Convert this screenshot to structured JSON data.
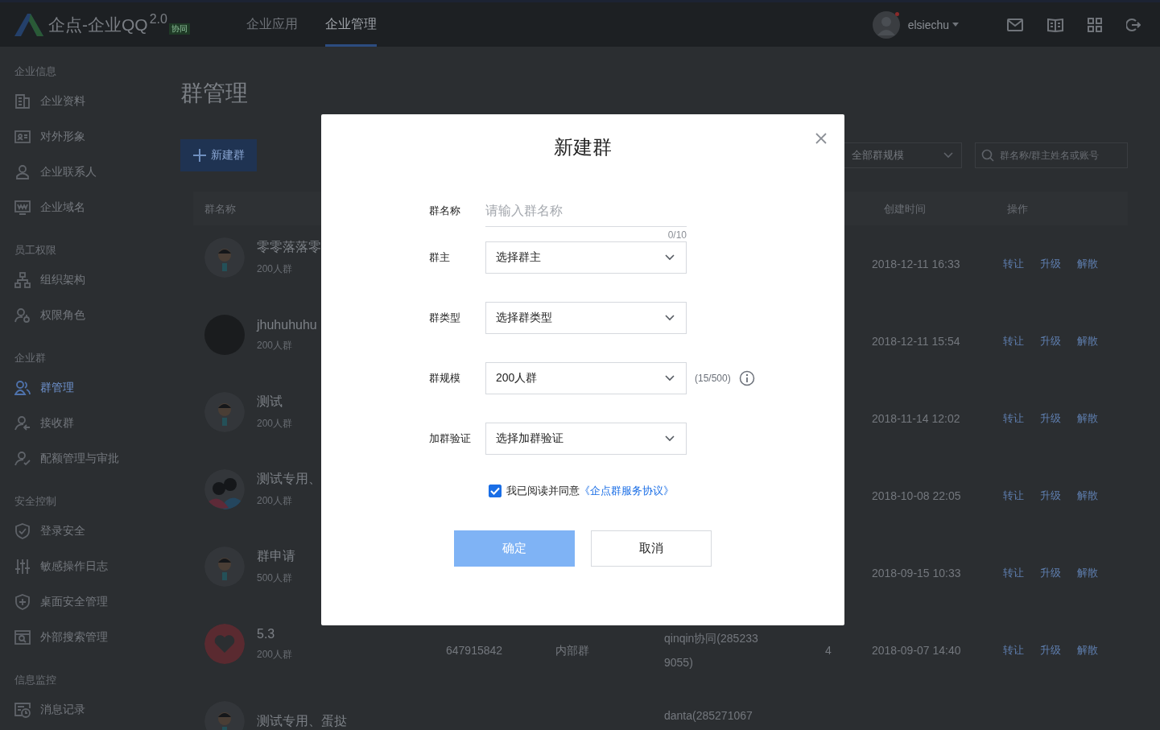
{
  "topbar": {
    "brand": "企点-企业QQ",
    "version": "2.0",
    "badge": "协同",
    "nav": [
      {
        "label": "企业应用",
        "selected": false
      },
      {
        "label": "企业管理",
        "selected": true
      }
    ],
    "user": {
      "name": "elsiechu",
      "unread": true
    }
  },
  "sidebar": {
    "sections": [
      {
        "title": "企业信息",
        "items": [
          {
            "label": "企业资料",
            "selected": false
          },
          {
            "label": "对外形象",
            "selected": false
          },
          {
            "label": "企业联系人",
            "selected": false
          },
          {
            "label": "企业域名",
            "selected": false
          }
        ]
      },
      {
        "title": "员工权限",
        "items": [
          {
            "label": "组织架构",
            "selected": false
          },
          {
            "label": "权限角色",
            "selected": false
          }
        ]
      },
      {
        "title": "企业群",
        "items": [
          {
            "label": "群管理",
            "selected": true
          },
          {
            "label": "接收群",
            "selected": false
          },
          {
            "label": "配额管理与审批",
            "selected": false
          }
        ]
      },
      {
        "title": "安全控制",
        "items": [
          {
            "label": "登录安全",
            "selected": false
          },
          {
            "label": "敏感操作日志",
            "selected": false
          },
          {
            "label": "桌面安全管理",
            "selected": false
          },
          {
            "label": "外部搜索管理",
            "selected": false
          }
        ]
      },
      {
        "title": "信息监控",
        "items": [
          {
            "label": "消息记录",
            "selected": false
          }
        ]
      }
    ]
  },
  "page": {
    "title": "群管理",
    "new_button": "新建群",
    "size_filter": "全部群规模",
    "search": {
      "placeholder": "群名称/群主姓名或账号"
    }
  },
  "table": {
    "columns": [
      "群名称",
      "创建时间",
      "操作"
    ],
    "rows": [
      {
        "kind": "person",
        "name": "零零落落零",
        "size": "200人群",
        "created": "2018-12-11 16:33",
        "actions": [
          "转让",
          "升级",
          "解散"
        ]
      },
      {
        "kind": "photo",
        "name": "jhuhuhuhu",
        "size": "200人群",
        "created": "2018-12-11 15:54",
        "actions": [
          "转让",
          "升级",
          "解散"
        ]
      },
      {
        "kind": "person",
        "name": "测试",
        "size": "200人群",
        "created": "2018-11-14 12:02",
        "actions": [
          "转让",
          "升级",
          "解散"
        ]
      },
      {
        "kind": "couple",
        "name": "测试专用、",
        "size": "200人群",
        "created": "2018-10-08 22:05",
        "actions": [
          "转让",
          "升级",
          "解散"
        ]
      },
      {
        "kind": "person",
        "name": "群申请",
        "size": "500人群",
        "created": "2018-09-15 10:33",
        "actions": [
          "转让",
          "升级",
          "解散"
        ]
      },
      {
        "kind": "heart",
        "name": "5.3",
        "size": "200人群",
        "group_id": "647915842",
        "type": "内部群",
        "owner": "qinqin协同(2852339055)",
        "members": "4",
        "created": "2018-09-07 14:40",
        "actions": [
          "转让",
          "升级",
          "解散"
        ]
      },
      {
        "kind": "person",
        "name": "测试专用、蛋挞",
        "owner": "danta(285271067"
      }
    ]
  },
  "dialog": {
    "title": "新建群",
    "fields": [
      {
        "kind": "text",
        "label": "群名称",
        "placeholder": "请输入群名称",
        "counter": "0/10"
      },
      {
        "kind": "select",
        "label": "群主",
        "value": "选择群主"
      },
      {
        "kind": "select",
        "label": "群类型",
        "value": "选择群类型"
      },
      {
        "kind": "select",
        "label": "群规模",
        "value": "200人群",
        "note": "(15/500)",
        "info": true
      },
      {
        "kind": "select",
        "label": "加群验证",
        "value": "选择加群验证"
      }
    ],
    "agreement": {
      "checked": true,
      "text": "我已阅读并同意",
      "link": "《企点群服务协议》"
    },
    "buttons": [
      {
        "label": "确定",
        "kind": "primary",
        "disabled": true
      },
      {
        "label": "取消",
        "kind": "default",
        "disabled": false
      }
    ]
  }
}
